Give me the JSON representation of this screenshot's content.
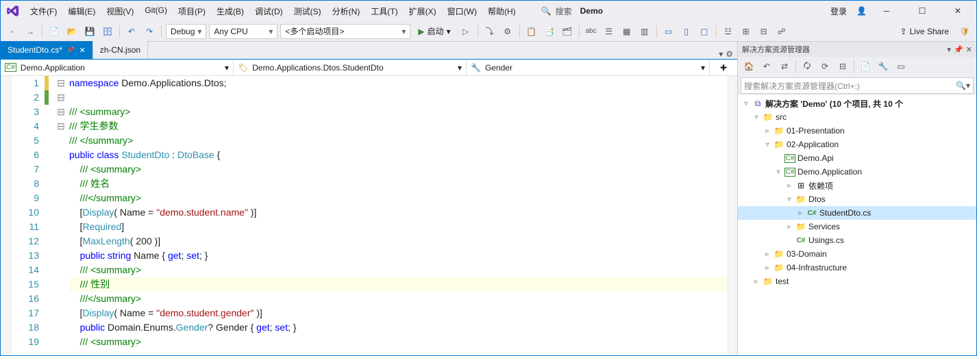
{
  "title": {
    "app_name": "Demo",
    "login": "登录",
    "search_label": "搜索"
  },
  "menu": [
    "文件(F)",
    "编辑(E)",
    "视图(V)",
    "Git(G)",
    "项目(P)",
    "生成(B)",
    "调试(D)",
    "测试(S)",
    "分析(N)",
    "工具(T)",
    "扩展(X)",
    "窗口(W)",
    "帮助(H)"
  ],
  "toolbar": {
    "config": "Debug",
    "platform": "Any CPU",
    "startup": "<多个启动项目>",
    "start_label": "启动",
    "liveshare": "Live Share"
  },
  "tabs": [
    {
      "label": "StudentDto.cs*",
      "active": true
    },
    {
      "label": "zh-CN.json",
      "active": false
    }
  ],
  "navbar": {
    "project": "Demo.Application",
    "type": "Demo.Applications.Dtos.StudentDto",
    "member": "Gender"
  },
  "code": {
    "lines": [
      {
        "n": 1,
        "fold": "",
        "mark": "",
        "html": "<span class='kw'>namespace</span> Demo.Applications.Dtos;"
      },
      {
        "n": 2,
        "fold": "",
        "mark": "",
        "html": ""
      },
      {
        "n": 3,
        "fold": "-",
        "mark": "",
        "html": "<span class='cmt'>/// &lt;summary&gt;</span>"
      },
      {
        "n": 4,
        "fold": "",
        "mark": "",
        "html": "<span class='cmt'>/// 学生参数</span>"
      },
      {
        "n": 5,
        "fold": "",
        "mark": "",
        "html": "<span class='cmt'>/// &lt;/summary&gt;</span>"
      },
      {
        "n": 6,
        "fold": "-",
        "mark": "",
        "html": "<span class='kw'>public</span> <span class='kw'>class</span> <span class='type'>StudentDto</span> : <span class='type'>DtoBase</span> {"
      },
      {
        "n": 7,
        "fold": "-",
        "mark": "",
        "html": "    <span class='cmt'>/// &lt;summary&gt;</span>"
      },
      {
        "n": 8,
        "fold": "",
        "mark": "",
        "html": "    <span class='cmt'>/// 姓名</span>"
      },
      {
        "n": 9,
        "fold": "",
        "mark": "",
        "html": "    <span class='cmt'>///&lt;/summary&gt;</span>"
      },
      {
        "n": 10,
        "fold": "",
        "mark": "",
        "html": "    [<span class='type'>Display</span>( Name = <span class='str'>\"demo.student.name\"</span> )]"
      },
      {
        "n": 11,
        "fold": "",
        "mark": "",
        "html": "    [<span class='type'>Required</span>]"
      },
      {
        "n": 12,
        "fold": "",
        "mark": "",
        "html": "    [<span class='type'>MaxLength</span>( 200 )]"
      },
      {
        "n": 13,
        "fold": "",
        "mark": "",
        "html": "    <span class='kw'>public</span> <span class='kw'>string</span> Name { <span class='kw'>get</span>; <span class='kw'>set</span>; }"
      },
      {
        "n": 14,
        "fold": "-",
        "mark": "",
        "html": "    <span class='cmt'>/// &lt;summary&gt;</span>"
      },
      {
        "n": 15,
        "fold": "",
        "mark": "yellow",
        "html": "    <span class='cmt'>/// 性别</span>",
        "hi": true
      },
      {
        "n": 16,
        "fold": "",
        "mark": "",
        "html": "    <span class='cmt'>///&lt;/summary&gt;</span>"
      },
      {
        "n": 17,
        "fold": "",
        "mark": "",
        "html": "    [<span class='type'>Display</span>( Name = <span class='str'>\"demo.student.gender\"</span> )]"
      },
      {
        "n": 18,
        "fold": "",
        "mark": "green",
        "html": "    <span class='kw'>public</span> Domain.Enums.<span class='type'>Gender</span>? Gender { <span class='kw'>get</span>; <span class='kw'>set</span>; }"
      },
      {
        "n": 19,
        "fold": "",
        "mark": "",
        "html": "    <span class='cmt'>/// &lt;summary&gt;</span>"
      }
    ]
  },
  "solution": {
    "title": "解决方案资源管理器",
    "search_placeholder": "搜索解决方案资源管理器(Ctrl+;)",
    "root": "解决方案 'Demo' (10 个项目, 共 10 个",
    "tree": [
      {
        "depth": 0,
        "exp": "▿",
        "icon": "folder",
        "label": "src"
      },
      {
        "depth": 1,
        "exp": "▹",
        "icon": "folder",
        "label": "01-Presentation"
      },
      {
        "depth": 1,
        "exp": "▿",
        "icon": "folder",
        "label": "02-Application"
      },
      {
        "depth": 2,
        "exp": "",
        "icon": "proj",
        "label": "Demo.Api"
      },
      {
        "depth": 2,
        "exp": "▿",
        "icon": "proj",
        "label": "Demo.Application"
      },
      {
        "depth": 3,
        "exp": "▹",
        "icon": "dep",
        "label": "依赖项"
      },
      {
        "depth": 3,
        "exp": "▿",
        "icon": "folder",
        "label": "Dtos"
      },
      {
        "depth": 4,
        "exp": "▹",
        "icon": "cs",
        "label": "StudentDto.cs",
        "selected": true
      },
      {
        "depth": 3,
        "exp": "▹",
        "icon": "folder",
        "label": "Services"
      },
      {
        "depth": 3,
        "exp": "",
        "icon": "cs",
        "label": "Usings.cs"
      },
      {
        "depth": 1,
        "exp": "▹",
        "icon": "folder",
        "label": "03-Domain"
      },
      {
        "depth": 1,
        "exp": "▹",
        "icon": "folder",
        "label": "04-Infrastructure"
      },
      {
        "depth": 0,
        "exp": "▹",
        "icon": "folder",
        "label": "test"
      }
    ]
  }
}
